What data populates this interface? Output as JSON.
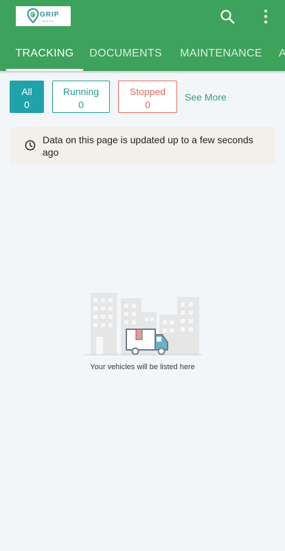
{
  "header": {
    "logo": {
      "text": "GRIP",
      "subtext": "TRACK"
    },
    "icons": {
      "search": "search-icon",
      "menu": "more-vert-icon"
    }
  },
  "tabs": [
    {
      "label": "TRACKING",
      "active": true
    },
    {
      "label": "DOCUMENTS",
      "active": false
    },
    {
      "label": "MAINTENANCE",
      "active": false
    },
    {
      "label": "A",
      "active": false
    }
  ],
  "filters": {
    "all": {
      "label": "All",
      "count": "0"
    },
    "running": {
      "label": "Running",
      "count": "0"
    },
    "stopped": {
      "label": "Stopped",
      "count": "0"
    },
    "see_more": "See More"
  },
  "notice": {
    "icon": "clock-icon",
    "text": "Data on this page is updated up to a few seconds ago"
  },
  "empty_state": {
    "illustration": "city-truck-illustration",
    "text": "Your vehicles will be listed here"
  },
  "colors": {
    "primary": "#3da25b",
    "all_filter": "#1fa2aa",
    "running": "#1f9f8e",
    "stopped": "#e06b5c",
    "background": "#f2f6f9"
  }
}
